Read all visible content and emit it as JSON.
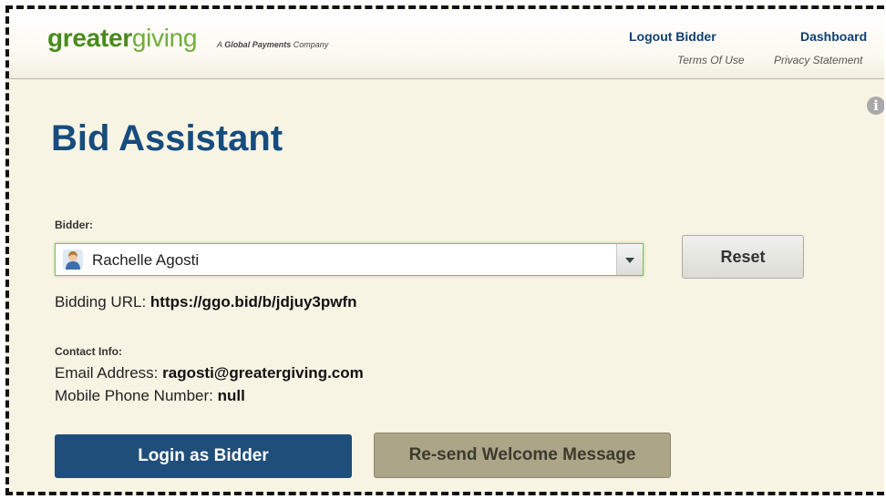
{
  "header": {
    "logo_bold": "greater",
    "logo_light": "giving",
    "tagline_prefix": "A",
    "tagline_bold": "Global Payments",
    "tagline_suffix": "Company",
    "logout_label": "Logout Bidder",
    "dashboard_label": "Dashboard",
    "terms_label": "Terms Of Use",
    "privacy_label": "Privacy Statement"
  },
  "page": {
    "title": "Bid Assistant",
    "info_icon": "info-icon"
  },
  "bidder": {
    "label": "Bidder:",
    "selected": "Rachelle Agosti",
    "avatar_icon": "user-avatar-icon",
    "reset_label": "Reset",
    "bidding_url_label": "Bidding URL:",
    "bidding_url_value": "https://ggo.bid/b/jdjuy3pwfn"
  },
  "contact": {
    "heading": "Contact Info:",
    "email_label": "Email Address:",
    "email_value": "ragosti@greatergiving.com",
    "phone_label": "Mobile Phone Number:",
    "phone_value": "null"
  },
  "actions": {
    "login_label": "Login as Bidder",
    "resend_label": "Re-send Welcome Message"
  },
  "colors": {
    "brand_green": "#4a8a1e",
    "title_blue": "#164c7e",
    "login_button": "#1f4e7b",
    "resend_button": "#aca588",
    "background": "#f8f4e4"
  }
}
